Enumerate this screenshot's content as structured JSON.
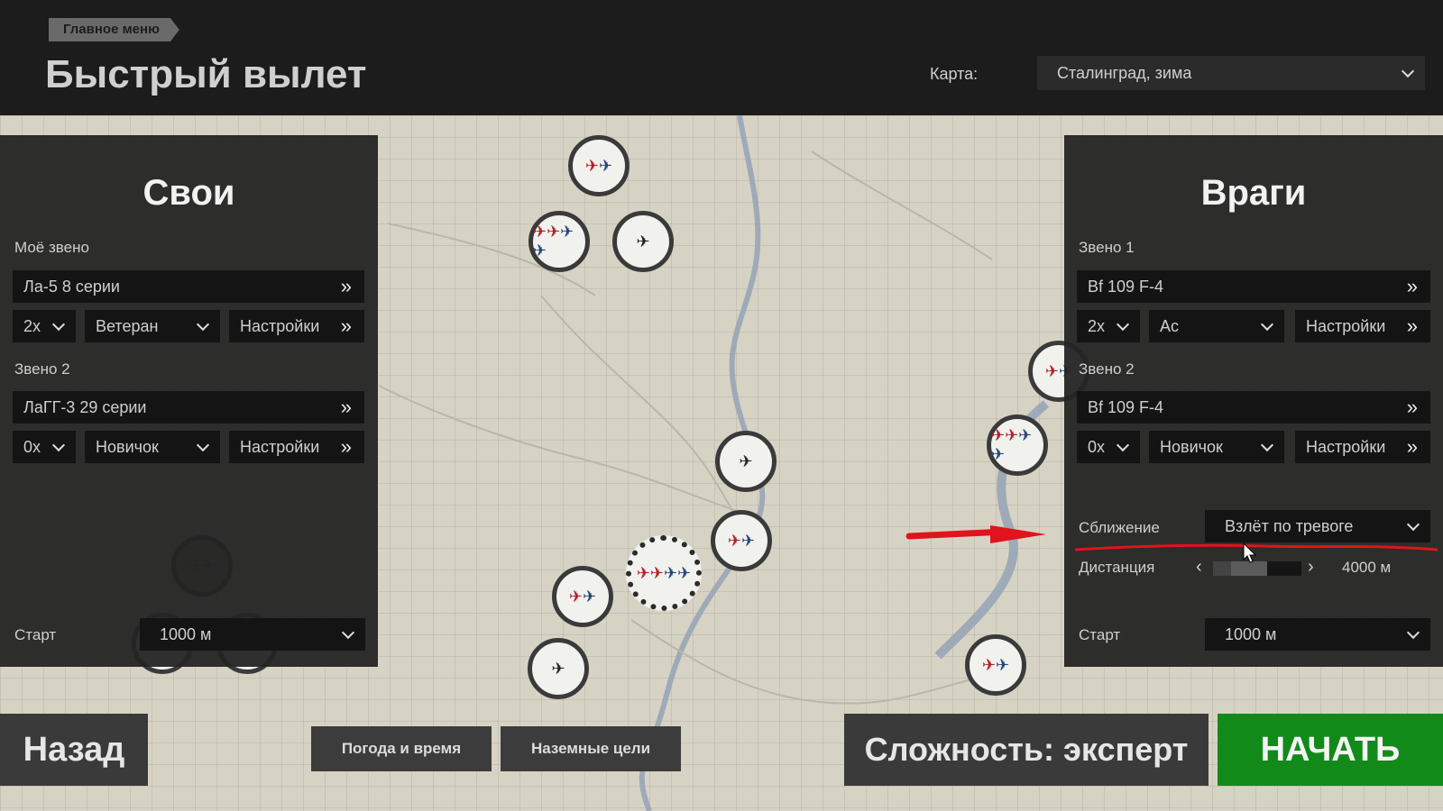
{
  "header": {
    "breadcrumb": "Главное меню",
    "title": "Быстрый вылет",
    "map_label": "Карта:",
    "map_value": "Сталинград, зима"
  },
  "allies": {
    "title": "Свои",
    "flight1": {
      "label": "Моё звено",
      "aircraft": "Ла-5 8 серии",
      "count": "2x",
      "skill": "Ветеран",
      "settings": "Настройки"
    },
    "flight2": {
      "label": "Звено 2",
      "aircraft": "ЛаГГ-3 29 серии",
      "count": "0x",
      "skill": "Новичок",
      "settings": "Настройки"
    },
    "start_label": "Старт",
    "start_value": "1000 м"
  },
  "enemies": {
    "title": "Враги",
    "flight1": {
      "label": "Звено 1",
      "aircraft": "Bf 109 F-4",
      "count": "2x",
      "skill": "Ас",
      "settings": "Настройки"
    },
    "flight2": {
      "label": "Звено 2",
      "aircraft": "Bf 109 F-4",
      "count": "0x",
      "skill": "Новичок",
      "settings": "Настройки"
    },
    "approach_label": "Сближение",
    "approach_value": "Взлёт по тревоге",
    "distance_label": "Дистанция",
    "distance_value": "4000 м",
    "distance_slider_fraction": 0.35,
    "start_label": "Старт",
    "start_value": "1000 м"
  },
  "footer": {
    "back": "Назад",
    "weather": "Погода и время",
    "ground_targets": "Наземные цели",
    "difficulty": "Сложность: эксперт",
    "start": "НАЧАТЬ"
  },
  "colors": {
    "start_button": "#118a1a",
    "annotation": "#e0141c",
    "allied_plane": "#b0222a",
    "enemy_plane": "#23467a"
  },
  "icons": [
    "chevron-down-icon",
    "double-chevron-right-icon",
    "airfield-marker-icon",
    "plane-icon",
    "mouse-cursor-icon",
    "arrow-annotation"
  ]
}
